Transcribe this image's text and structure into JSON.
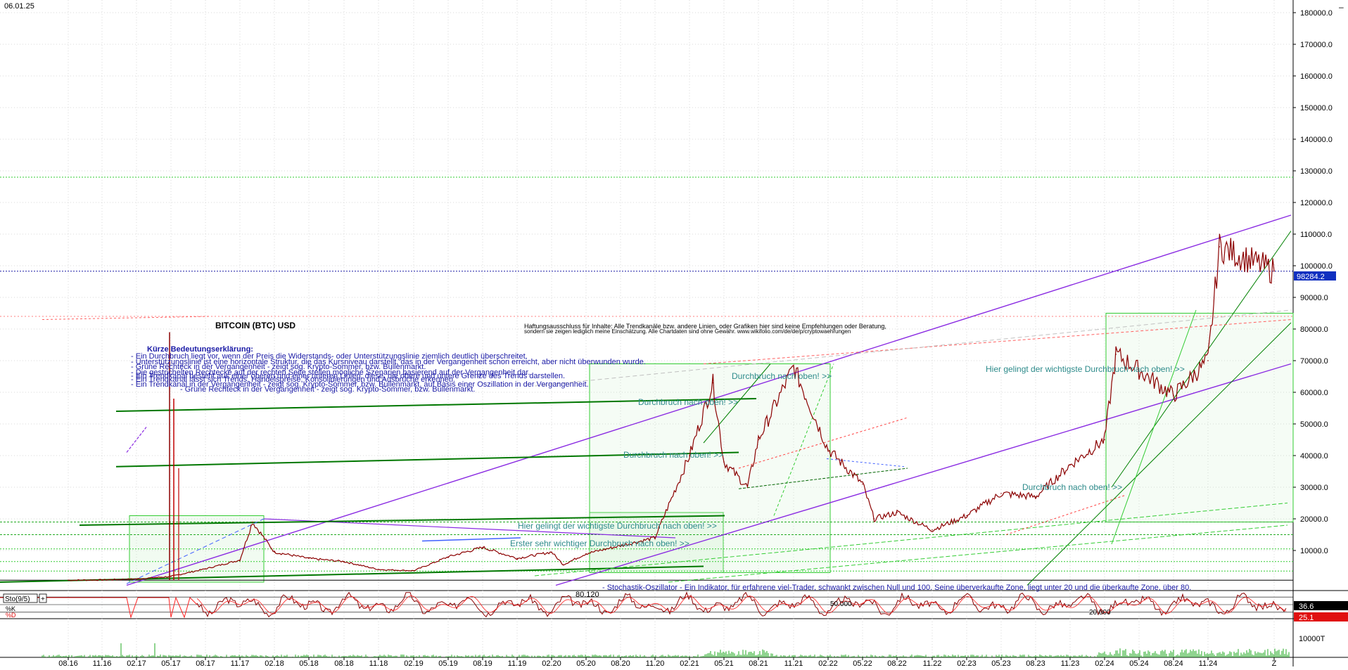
{
  "header": {
    "date_label": "06.01.25"
  },
  "chart_data": [
    {
      "type": "line",
      "title": "BITCOIN (BTC) USD",
      "y_axis": {
        "side": "right",
        "ticks": [
          "180000.0",
          "170000.0",
          "160000.0",
          "150000.0",
          "140000.0",
          "130000.0",
          "120000.0",
          "110000.0",
          "100000.0",
          "90000.0",
          "80000.0",
          "70000.0",
          "60000.0",
          "50000.0",
          "40000.0",
          "30000.0",
          "20000.0",
          "10000.0"
        ],
        "tick_values": [
          180000,
          170000,
          160000,
          150000,
          140000,
          130000,
          120000,
          110000,
          100000,
          90000,
          80000,
          70000,
          60000,
          50000,
          40000,
          30000,
          20000,
          10000
        ],
        "ylim": [
          -10000,
          185000
        ]
      },
      "x_axis": {
        "ticks": [
          "08.16",
          "11.16",
          "02.17",
          "05.17",
          "08.17",
          "11.17",
          "02.18",
          "05.18",
          "08.18",
          "11.18",
          "02.19",
          "05.19",
          "08.19",
          "11.19",
          "02.20",
          "05.20",
          "08.20",
          "11.20",
          "02.21",
          "05.21",
          "08.21",
          "11.21",
          "02.22",
          "05.22",
          "08.22",
          "11.22",
          "02.23",
          "05.23",
          "08.23",
          "11.23",
          "02.24",
          "05.24",
          "08.24",
          "11.24",
          "Z"
        ]
      },
      "current_price_label": "98284.2",
      "current_price": 98284.2,
      "series": [
        {
          "color": "#8b0000",
          "x": [
            "08.16",
            "11.16",
            "02.17",
            "05.17",
            "08.17",
            "11.17",
            "12.17",
            "02.18",
            "05.18",
            "08.18",
            "11.18",
            "02.19",
            "05.19",
            "08.19",
            "11.19",
            "02.20",
            "03.20",
            "05.20",
            "08.20",
            "11.20",
            "02.21",
            "04.21",
            "05.21",
            "07.21",
            "08.21",
            "11.21",
            "02.22",
            "05.22",
            "06.22",
            "08.22",
            "11.22",
            "02.23",
            "05.23",
            "08.23",
            "11.23",
            "02.24",
            "03.24",
            "05.24",
            "08.24",
            "11.24",
            "12.24",
            "Z"
          ],
          "values": [
            600,
            700,
            1000,
            1800,
            4200,
            7000,
            19000,
            9500,
            7500,
            6500,
            4000,
            3600,
            8000,
            11000,
            7500,
            9500,
            5500,
            9000,
            11500,
            14000,
            40000,
            63000,
            38000,
            30000,
            45000,
            68000,
            42000,
            31000,
            20000,
            22000,
            16500,
            21000,
            28000,
            27000,
            37000,
            45000,
            72000,
            67000,
            59000,
            70000,
            106000,
            98284
          ]
        }
      ],
      "annotations": [
        {
          "text": "Kürze Bedeutungserklärung:"
        },
        {
          "text": "- Ein Durchbruch liegt vor, wenn der Preis die Widerstands- oder Unterstützungslinie ziemlich deutlich überschreitet."
        },
        {
          "text": "- Unterstützungslinie ist eine horizontale Struktur, die das Kursniveau darstellt, das in der Vergangenheit schon erreicht, aber nicht überwunden wurde."
        },
        {
          "text": "- Grüne Rechteck in der Vergangenheit - zeigt sog. Krypto-Sommer, bzw. Bullenmarkt."
        },
        {
          "text": "- Die gestrichelten Rechtecke auf der rechten Seite stellen mögliche Szenarien basierend auf der Vergangenheit dar."
        },
        {
          "text": "- Ein Trendkanal besteht aus einer oberen und einer unteren Linien, diese, die obere und untere Grenze des Trends darstellen."
        },
        {
          "text": "- Ein Trendkanal lässt sich Trends, Handelspreise, Konsolidierungen und Ausbrüche erkennen."
        },
        {
          "text": "- Ein Trendkanal in der Vergangenheit - zeigt sog. Krypto-Sommer, bzw. Bullenmarkt, auf Basis einer Oszillation in der Vergangenheit."
        },
        {
          "text": "- Grüne Rechteck in der Vergangenheit - zeigt sog. Krypto-Sommer, bzw. Bullenmarkt."
        },
        {
          "text": "Haftungsausschluss für Inhalte: Alle Trendkanäle bzw. andere Linien, oder Grafiken hier sind keine Empfehlungen oder Beratung,"
        },
        {
          "text": "sondern sie zeigen lediglich meine Einschätzung. Alle Chartdaten sind ohne Gewähr. www.wikifolio.com/de/de/p/cryptowaehrungen"
        },
        {
          "text": "Durchbruch nach oben! >>"
        },
        {
          "text": "Durchbruch nach oben! >>"
        },
        {
          "text": "Durchbruch nach oben! >>"
        },
        {
          "text": "Hier gelingt der wichtigste Durchbruch nach oben! >>"
        },
        {
          "text": "Erster sehr wichtiger Durchbruch nach oben! >>"
        },
        {
          "text": "Hier gelingt der wichtigste Durchbruch nach oben! >>"
        },
        {
          "text": "Durchbruch nach oben! >>"
        },
        {
          "text": "- Stochastik-Oszillator - Ein Indikator, für erfahrene viel-Trader, schwankt zwischen Null und 100. Seine überverkaufte Zone, liegt unter 20 und die überkaufte Zone, über 80."
        }
      ]
    },
    {
      "type": "line",
      "title": "Sto(9/5)",
      "legend": [
        "%K",
        "%D"
      ],
      "levels": [
        "80.120",
        "50.000",
        "20.000"
      ],
      "level_values": [
        80,
        50,
        20
      ],
      "ylim": [
        0,
        100
      ],
      "last_values": [
        "36.6",
        "25.1"
      ],
      "series": [
        {
          "name": "%K",
          "color": "#8b0000",
          "values": [
            36.6
          ]
        },
        {
          "name": "%D",
          "color": "#ff0000",
          "values": [
            25.1
          ]
        }
      ]
    },
    {
      "type": "bar",
      "title": "Volume",
      "tick_label": "10000T"
    }
  ],
  "colors": {
    "price_line": "#8b0000",
    "trend_purple": "#8a2be2",
    "trend_green": "#008000",
    "light_green": "#33cc33",
    "annotation_blue": "#1a1aa6",
    "annotation_teal": "#2e8b8b",
    "current_price_bg": "#1030c0",
    "stoch_k_bg": "#000000",
    "stoch_d_bg": "#e01010"
  }
}
